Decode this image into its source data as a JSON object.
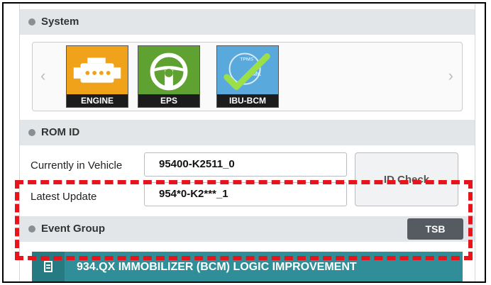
{
  "system": {
    "title": "System",
    "tiles": [
      {
        "label": "ENGINE",
        "icon": "engine-icon",
        "color": "#f0a21a"
      },
      {
        "label": "EPS",
        "icon": "steering-wheel-icon",
        "color": "#5fa232"
      },
      {
        "label": "IBU-BCM",
        "icon": "checkmark-icon",
        "color": "#5aa9dc",
        "art_text": [
          "TPMS",
          "SMK"
        ]
      }
    ],
    "prev_icon": "chevron-left-icon",
    "next_icon": "chevron-right-icon"
  },
  "rom_id": {
    "title": "ROM ID",
    "current_label": "Currently in Vehicle",
    "current_value": "95400-K2511_0",
    "latest_label": "Latest Update",
    "latest_value": "954*0-K2***_1",
    "id_check_label": "ID Check"
  },
  "event_group": {
    "title": "Event Group",
    "tsb_label": "TSB",
    "items": [
      {
        "icon": "document-icon",
        "text": "934.QX IMMOBILIZER (BCM) LOGIC IMPROVEMENT"
      }
    ]
  },
  "colors": {
    "header_bg": "#e3e6e8",
    "event_row_bg": "#2f8e97",
    "tsb_button_bg": "#555b61",
    "highlight_border": "#e8141b"
  }
}
